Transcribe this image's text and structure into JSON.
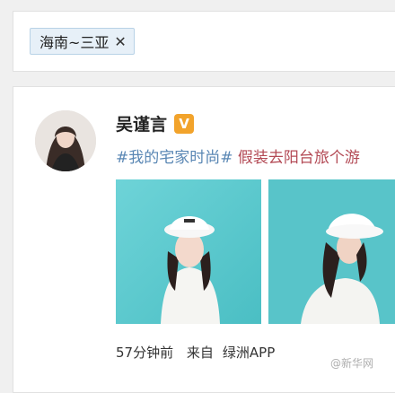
{
  "search": {
    "tag_label": "海南~三亚",
    "close_symbol": "✕"
  },
  "post": {
    "username": "吴谨言",
    "vip_badge": "V",
    "hashtag": "#我的宅家时尚#",
    "text": " 假装去阳台旅个游",
    "time": "57分钟前",
    "source_prefix": "来自",
    "source": "绿洲APP"
  },
  "watermark": "@新华网"
}
